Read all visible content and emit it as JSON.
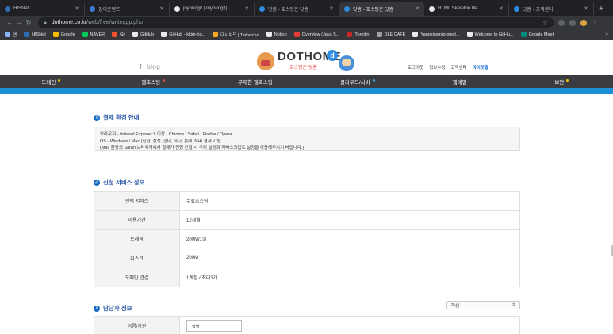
{
  "browser": {
    "tabs": [
      {
        "title": "HISNet",
        "color": "#2f6db5",
        "active": false
      },
      {
        "title": "강의콘텐츠",
        "color": "#3a7bd5",
        "active": false
      },
      {
        "title": "juyoungit (Juyoungit)",
        "color": "#e8eaed",
        "active": false
      },
      {
        "title": "닷홈 - 호스팅은 닷홈",
        "color": "#2f8de4",
        "active": false
      },
      {
        "title": "닷홈 - 호스팅은 닷홈",
        "color": "#2f8de4",
        "active": true
      },
      {
        "title": "HTML Skeleton file",
        "color": "#e8eaed",
        "active": false
      },
      {
        "title": "닷홈 - 고객센터",
        "color": "#2f8de4",
        "active": false
      }
    ],
    "url_host": "dothome.co.kr",
    "url_path": "/web/free/writeapp.php",
    "bookmarks": [
      {
        "label": "앱",
        "color": "#8ab4f8"
      },
      {
        "label": "HISNet",
        "color": "#2f6db5"
      },
      {
        "label": "Google",
        "color": "#fbbc04"
      },
      {
        "label": "NAVER",
        "color": "#03c75a"
      },
      {
        "label": "Git",
        "color": "#f05133"
      },
      {
        "label": "GitHub",
        "color": "#e8eaed"
      },
      {
        "label": "GitHub - kkim-hg...",
        "color": "#e8eaed"
      },
      {
        "label": "대시보드 | Tinkercad",
        "color": "#f9a825"
      },
      {
        "label": "Notion",
        "color": "#e8eaed"
      },
      {
        "label": "Overview (Java S...",
        "color": "#e53935"
      },
      {
        "label": "Turnitin",
        "color": "#c62828"
      },
      {
        "label": "DLE CAFE",
        "color": "#9e9e9e"
      },
      {
        "label": "Yangsiwan/project...",
        "color": "#e8eaed"
      },
      {
        "label": "Welcome to GitHu...",
        "color": "#e8eaed"
      },
      {
        "label": "Google Meet",
        "color": "#00897b"
      }
    ]
  },
  "site": {
    "blog": "blog",
    "logo_text": "DOTHOME",
    "logo_sub": "호스팅은 닷홈",
    "top_links": [
      "로그아웃",
      "정보수정",
      "고객센터",
      "마이닷홈"
    ],
    "nav": [
      {
        "label": "도메인",
        "dot": "#f2c200"
      },
      {
        "label": "웹호스팅",
        "dot": "#e54848"
      },
      {
        "label": "무제한 웹호스팅",
        "dot": ""
      },
      {
        "label": "클라우드/서버",
        "dot": "#3fa9f5"
      },
      {
        "label": "웹메일",
        "dot": ""
      },
      {
        "label": "보안",
        "dot": "#f2c200"
      }
    ]
  },
  "payment_env": {
    "title": "결제 환경 안내",
    "lines": [
      "브라우저 - Internet Explorer 9 이상 / Chrome / Safari / Firefox / Opera",
      "OS - Windows / Mac (신한, 삼성, 현대, 하나, 롯데, NH) 결제 가능",
      "(Mac 환경의 Safari 브라우저에서 결제가 진행 안될 시 쿠키 설정과 자바스크립트 설정을 허용해주시기 바랍니다.)"
    ]
  },
  "service_info": {
    "title": "신청 서비스 정보",
    "rows": [
      {
        "label": "선택 서비스",
        "value": "무료호스팅"
      },
      {
        "label": "이용기간",
        "value": "12개월"
      },
      {
        "label": "트래픽",
        "value": "200M/1일"
      },
      {
        "label": "디스크",
        "value": "200M"
      },
      {
        "label": "도메인 연결",
        "value": "1계정 / 최대3개"
      }
    ]
  },
  "manager_info": {
    "title": "담당자 정보",
    "type_select": "학생",
    "rows": [
      {
        "label": "이름/기관",
        "value": "학생"
      }
    ]
  }
}
